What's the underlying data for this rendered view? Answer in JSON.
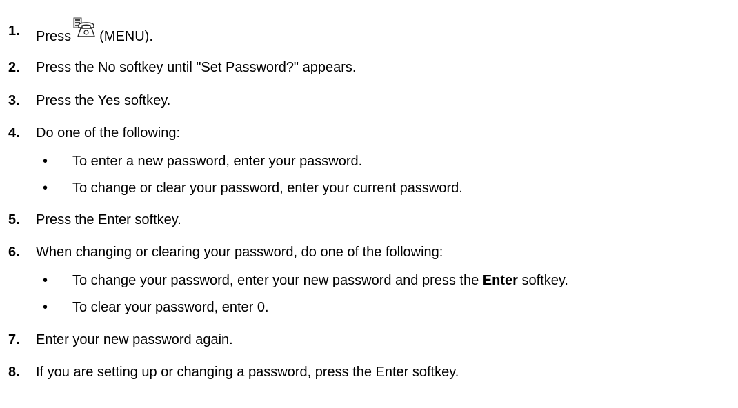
{
  "steps": [
    {
      "number": "1.",
      "text_before": "Press",
      "icon": "menu-phone-icon",
      "text_after": "(MENU)."
    },
    {
      "number": "2.",
      "text": "Press the No softkey until \"Set Password?\" appears."
    },
    {
      "number": "3.",
      "text": "Press the Yes softkey."
    },
    {
      "number": "4.",
      "text": "Do one of the following:",
      "bullets": [
        {
          "text": "To enter a new password, enter your password."
        },
        {
          "text": "To change or clear your password, enter your current password."
        }
      ]
    },
    {
      "number": "5.",
      "text": "Press the Enter softkey."
    },
    {
      "number": "6.",
      "text": "When changing or clearing your password, do one of the following:",
      "bullets": [
        {
          "text_before": "To change your password, enter your new password and press the ",
          "bold": "Enter",
          "text_after": " softkey."
        },
        {
          "text": "To clear your password, enter 0."
        }
      ]
    },
    {
      "number": "7.",
      "text": "Enter your new password again."
    },
    {
      "number": "8.",
      "text": "If you are setting up or changing a password, press the Enter softkey."
    }
  ],
  "bullet_glyph": "•"
}
